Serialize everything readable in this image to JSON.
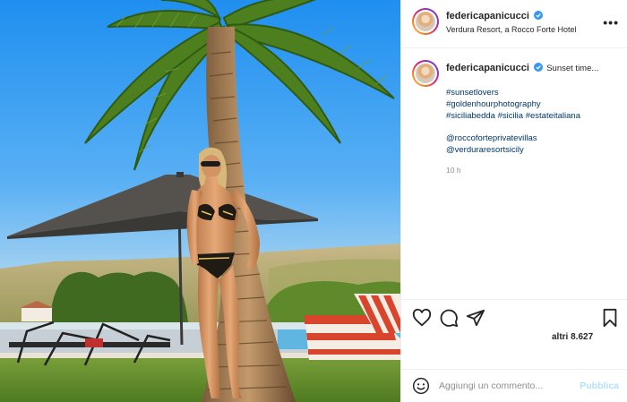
{
  "post": {
    "username": "federicapanicucci",
    "location": "Verdura Resort, a Rocco Forte Hotel",
    "more_label": "•••",
    "caption_text": "Sunset time...",
    "hashtags": [
      "#sunsetlovers",
      "#goldenhourphotography",
      "#siciliabedda #sicilia #estateitaliana"
    ],
    "mentions": [
      "@roccoforteprivatevillas",
      "@verduraresortsicily"
    ],
    "age": "10 h",
    "likes": "altri 8.627"
  },
  "comment": {
    "placeholder": "Aggiungi un commento...",
    "post_label": "Pubblica"
  },
  "icons": {
    "like": "heart-icon",
    "comment": "comment-icon",
    "share": "share-icon",
    "save": "bookmark-icon",
    "emoji": "emoji-icon",
    "verified": "verified-badge-icon"
  },
  "colors": {
    "link": "#00376b",
    "verified": "#3897f0",
    "post_disabled": "#b2dffc",
    "muted": "#8e8e8e"
  }
}
